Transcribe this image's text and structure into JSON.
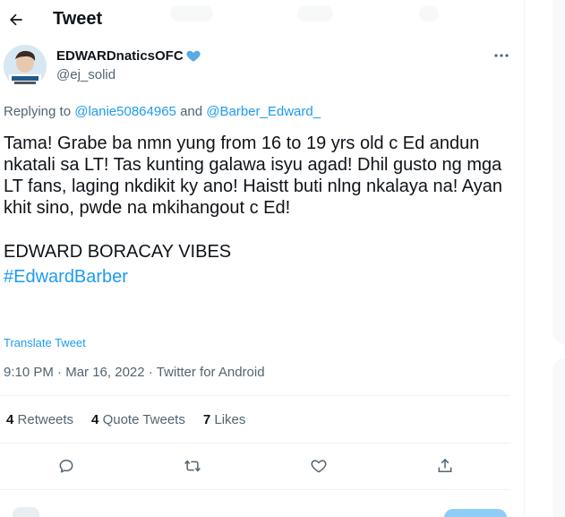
{
  "header": {
    "title": "Tweet",
    "back_icon": "arrow-left-icon"
  },
  "author": {
    "display_name": "EDWARDnaticsOFC",
    "handle": "@ej_solid",
    "verified_icon": "blue-heart-icon",
    "verified_color": "#5aa9e6"
  },
  "reply": {
    "prefix": "Replying to",
    "mention1": "@lanie50864965",
    "conjunction": "and",
    "mention2": "@Barber_Edward_"
  },
  "tweet": {
    "paragraph1": "Tama! Grabe ba nmn yung from 16 to 19 yrs old c Ed andun nkatali sa LT! Tas kunting galawa isyu agad! Dhil gusto ng mga LT fans, laging nkdikit ky ano! Haistt buti nlng nkalaya na! Ayan khit sino, pwde na mkihangout c Ed!",
    "paragraph2": "EDWARD BORACAY VIBES",
    "hashtag": "#EdwardBarber",
    "translate_label": "Translate Tweet"
  },
  "meta": {
    "time": "9:10 PM",
    "separator": "·",
    "date": "Mar 16, 2022",
    "client": "Twitter for Android"
  },
  "stats": {
    "retweets_count": "4",
    "retweets_label": "Retweets",
    "quotes_count": "4",
    "quotes_label": "Quote Tweets",
    "likes_count": "7",
    "likes_label": "Likes"
  },
  "actions": {
    "reply_icon": "reply-icon",
    "retweet_icon": "retweet-icon",
    "like_icon": "heart-icon",
    "share_icon": "share-icon"
  },
  "colors": {
    "accent": "#1d9bf0",
    "text": "#0f1419",
    "secondary": "#536471",
    "divider": "#eff3f4"
  }
}
